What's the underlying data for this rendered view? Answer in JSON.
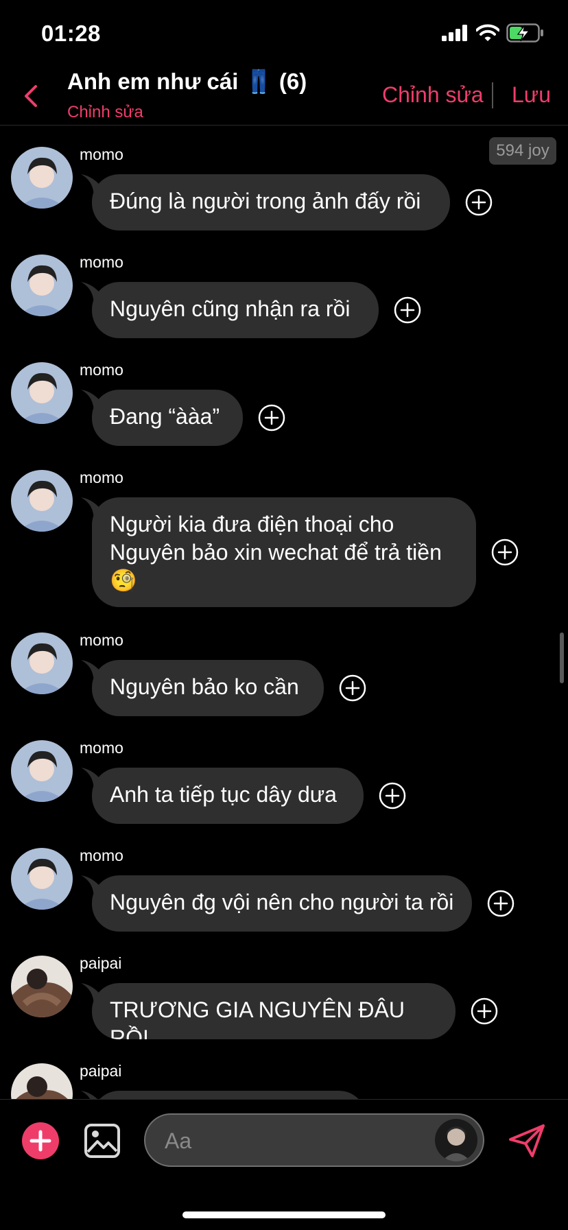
{
  "status": {
    "time": "01:28"
  },
  "header": {
    "title": "Anh em như cái 👖 (6)",
    "subtitle": "Chỉnh sửa",
    "edit_label": "Chỉnh sửa",
    "save_label": "Lưu"
  },
  "joy_badge": "594 joy",
  "messages": [
    {
      "sender": "momo",
      "text": "Đúng là người trong ảnh đấy rồi"
    },
    {
      "sender": "momo",
      "text": "Nguyên cũng nhận ra rồi"
    },
    {
      "sender": "momo",
      "text": "Đang “ààa”"
    },
    {
      "sender": "momo",
      "text": "Người kia đưa điện thoại cho\nNguyên bảo xin wechat để trả tiền\n🧐"
    },
    {
      "sender": "momo",
      "text": "Nguyên bảo ko cần"
    },
    {
      "sender": "momo",
      "text": "Anh ta tiếp tục dây dưa"
    },
    {
      "sender": "momo",
      "text": "Nguyên đg vội nên cho người ta rồi"
    },
    {
      "sender": "paipai",
      "text": "TRƯƠNG GIA NGUYÊN ĐÂU RỒI"
    },
    {
      "sender": "paipai",
      "text": ""
    }
  ],
  "composer": {
    "placeholder": "Aa"
  },
  "colors": {
    "accent": "#ef3d6a",
    "bubble": "#2f2f2f",
    "background": "#000000"
  },
  "icons": [
    "back-chevron-icon",
    "plus-circle-icon",
    "add-icon",
    "image-icon",
    "send-icon",
    "signal-icon",
    "wifi-icon",
    "battery-charging-icon"
  ]
}
